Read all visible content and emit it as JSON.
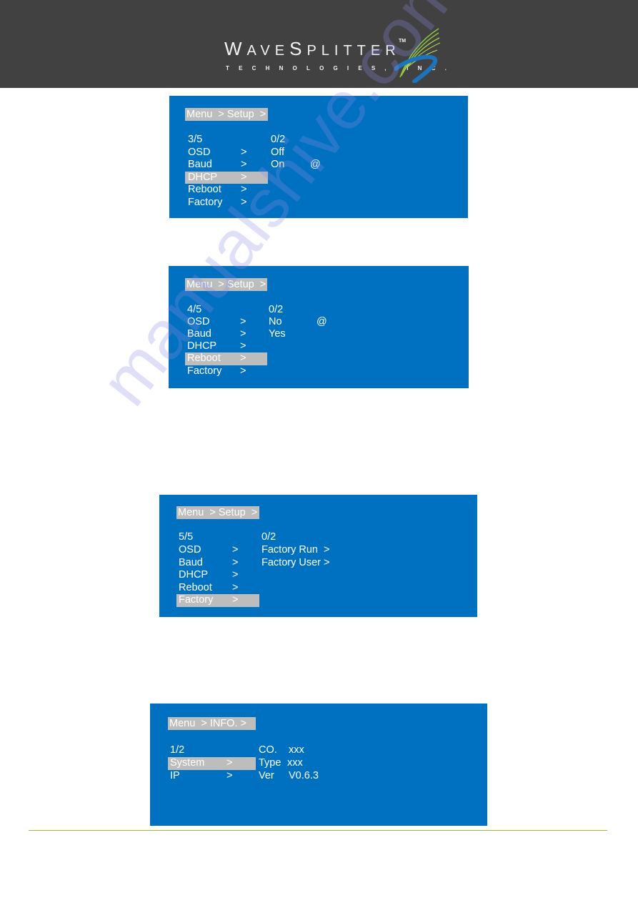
{
  "header": {
    "logo": {
      "wordmark_W": "W",
      "wordmark_rest_1": "AVE",
      "wordmark_S": "S",
      "wordmark_rest_2": "PLITTER",
      "trademark": "TM",
      "subtitle": "TECHNOLOGIES, INC."
    },
    "background_color": "#414141"
  },
  "watermark": "manualshive.com",
  "colors": {
    "panel_bg": "#0070c0",
    "highlight_bg": "#bdbdbd",
    "footer_rule": "#9bbb3b"
  },
  "panels": [
    {
      "breadcrumb": "Menu  > Setup  >",
      "page_indicator": "3/5",
      "sub_indicator": "0/2",
      "menu_items": [
        {
          "label": "OSD",
          "arrow": ">"
        },
        {
          "label": "Baud",
          "arrow": ">"
        },
        {
          "label": "DHCP",
          "arrow": ">",
          "selected": true
        },
        {
          "label": "Reboot",
          "arrow": ">"
        },
        {
          "label": "Factory",
          "arrow": ">"
        }
      ],
      "options": [
        "Off",
        "On"
      ],
      "current_marker": "@",
      "current_option_index": 1
    },
    {
      "breadcrumb": "Menu  > Setup  >",
      "page_indicator": "4/5",
      "sub_indicator": "0/2",
      "menu_items": [
        {
          "label": "OSD",
          "arrow": ">"
        },
        {
          "label": "Baud",
          "arrow": ">"
        },
        {
          "label": "DHCP",
          "arrow": ">"
        },
        {
          "label": "Reboot",
          "arrow": ">",
          "selected": true
        },
        {
          "label": "Factory",
          "arrow": ">"
        }
      ],
      "options": [
        "No",
        "Yes"
      ],
      "current_marker": "@",
      "current_option_index": 0
    },
    {
      "breadcrumb": "Menu  > Setup  >",
      "page_indicator": "5/5",
      "sub_indicator": "0/2",
      "menu_items": [
        {
          "label": "OSD",
          "arrow": ">"
        },
        {
          "label": "Baud",
          "arrow": ">"
        },
        {
          "label": "DHCP",
          "arrow": ">"
        },
        {
          "label": "Reboot",
          "arrow": ">"
        },
        {
          "label": "Factory",
          "arrow": ">",
          "selected": true
        }
      ],
      "options": [
        "Factory Run  >",
        "Factory User >"
      ]
    },
    {
      "breadcrumb": "Menu  > INFO. >",
      "page_indicator": "1/2",
      "menu_items": [
        {
          "label": "System",
          "arrow": ">",
          "selected": true
        },
        {
          "label": "IP",
          "arrow": ">"
        }
      ],
      "info": [
        {
          "key": "CO.",
          "value": "xxx"
        },
        {
          "key": "Type",
          "value": "xxx"
        },
        {
          "key": "Ver",
          "value": "V0.6.3"
        }
      ]
    }
  ]
}
